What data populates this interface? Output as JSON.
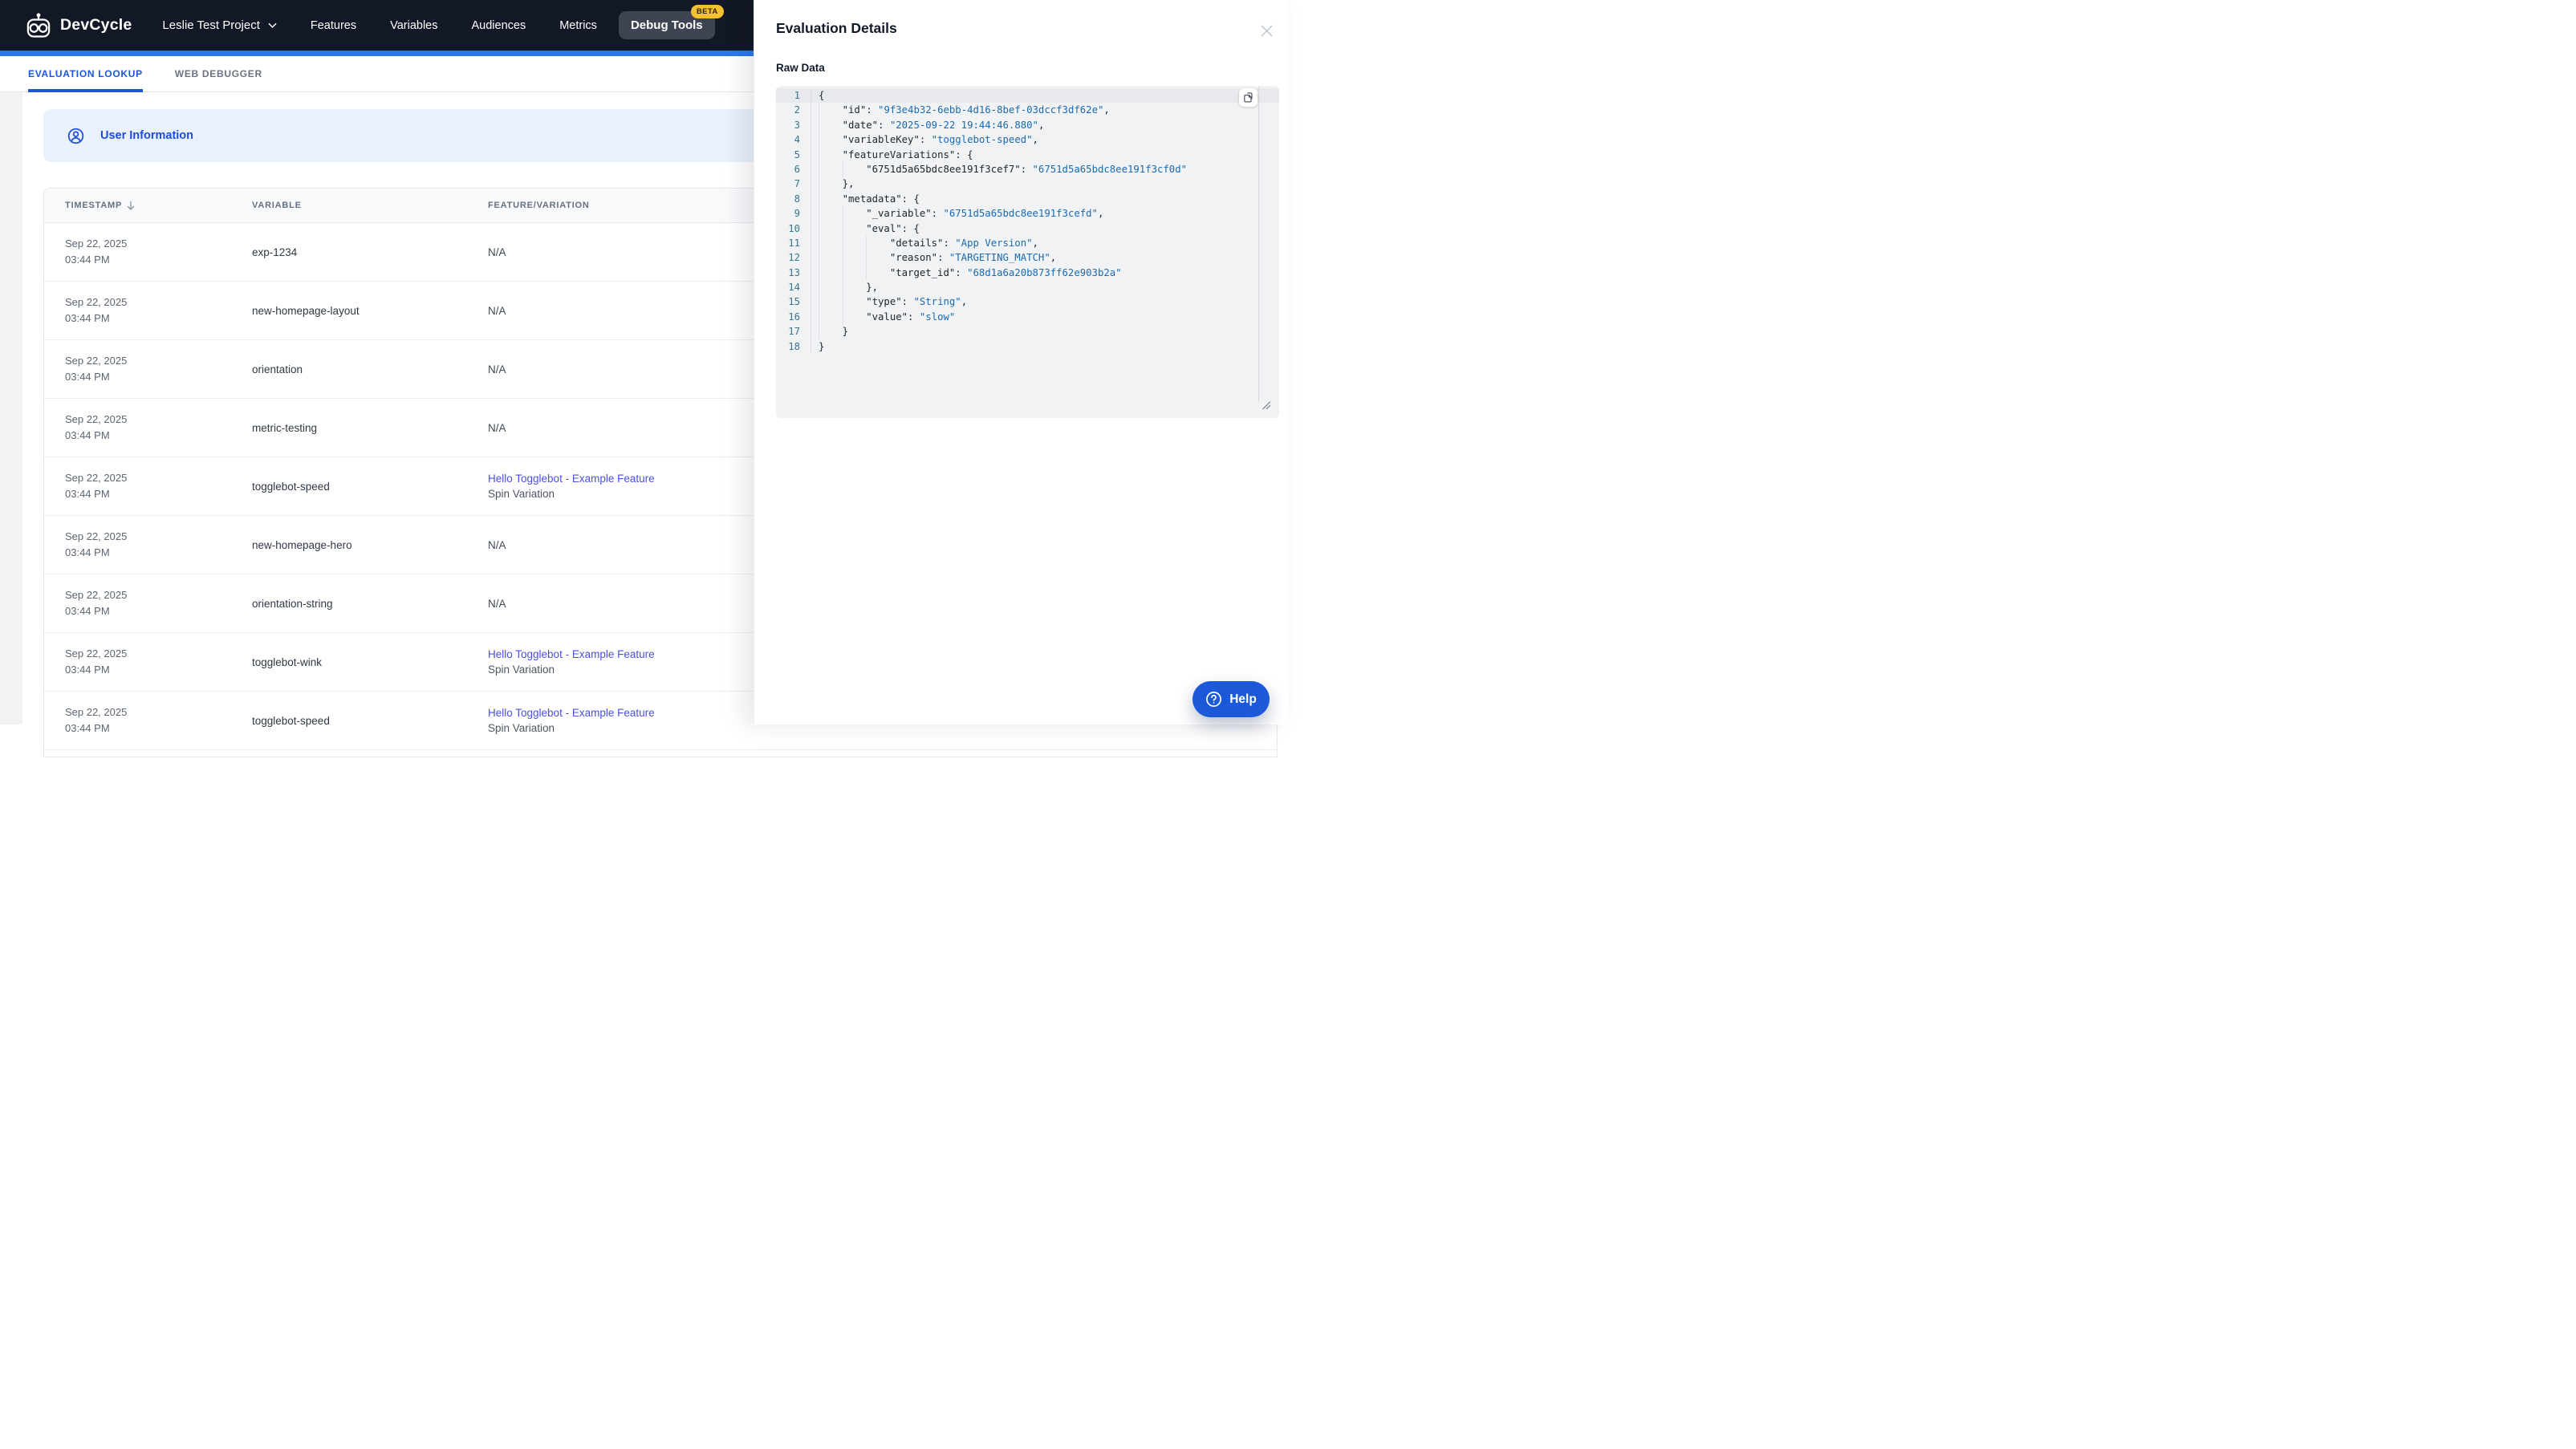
{
  "nav": {
    "brand": "DevCycle",
    "project": "Leslie Test Project",
    "items": [
      "Features",
      "Variables",
      "Audiences",
      "Metrics"
    ],
    "debug_tools": "Debug Tools",
    "beta": "BETA"
  },
  "tabs": {
    "active": "EVALUATION LOOKUP",
    "inactive": "WEB DEBUGGER"
  },
  "banner": {
    "title": "User Information"
  },
  "table": {
    "columns": [
      "TIMESTAMP",
      "VARIABLE",
      "FEATURE/VARIATION"
    ],
    "sort": {
      "column": "TIMESTAMP",
      "direction": "descending"
    },
    "rows": [
      {
        "date": "Sep 22, 2025",
        "time": "03:44 PM",
        "variable": "exp-1234",
        "feature": "N/A",
        "variation": "",
        "is_link": false
      },
      {
        "date": "Sep 22, 2025",
        "time": "03:44 PM",
        "variable": "new-homepage-layout",
        "feature": "N/A",
        "variation": "",
        "is_link": false
      },
      {
        "date": "Sep 22, 2025",
        "time": "03:44 PM",
        "variable": "orientation",
        "feature": "N/A",
        "variation": "",
        "is_link": false
      },
      {
        "date": "Sep 22, 2025",
        "time": "03:44 PM",
        "variable": "metric-testing",
        "feature": "N/A",
        "variation": "",
        "is_link": false
      },
      {
        "date": "Sep 22, 2025",
        "time": "03:44 PM",
        "variable": "togglebot-speed",
        "feature": "Hello Togglebot - Example Feature",
        "variation": "Spin Variation",
        "is_link": true
      },
      {
        "date": "Sep 22, 2025",
        "time": "03:44 PM",
        "variable": "new-homepage-hero",
        "feature": "N/A",
        "variation": "",
        "is_link": false
      },
      {
        "date": "Sep 22, 2025",
        "time": "03:44 PM",
        "variable": "orientation-string",
        "feature": "N/A",
        "variation": "",
        "is_link": false
      },
      {
        "date": "Sep 22, 2025",
        "time": "03:44 PM",
        "variable": "togglebot-wink",
        "feature": "Hello Togglebot - Example Feature",
        "variation": "Spin Variation",
        "is_link": true
      },
      {
        "date": "Sep 22, 2025",
        "time": "03:44 PM",
        "variable": "togglebot-speed",
        "feature": "Hello Togglebot - Example Feature",
        "variation": "Spin Variation",
        "is_link": true
      }
    ]
  },
  "panel": {
    "title": "Evaluation Details",
    "raw_data_label": "Raw Data",
    "code": {
      "lines": [
        {
          "n": 1,
          "ind": 0,
          "seg": [
            [
              "tp",
              "{"
            ]
          ]
        },
        {
          "n": 2,
          "ind": 1,
          "seg": [
            [
              "tk",
              "\"id\""
            ],
            [
              "tp",
              ": "
            ],
            [
              "ts",
              "\"9f3e4b32-6ebb-4d16-8bef-03dccf3df62e\""
            ],
            [
              "tp",
              ","
            ]
          ]
        },
        {
          "n": 3,
          "ind": 1,
          "seg": [
            [
              "tk",
              "\"date\""
            ],
            [
              "tp",
              ": "
            ],
            [
              "ts",
              "\"2025-09-22 19:44:46.880\""
            ],
            [
              "tp",
              ","
            ]
          ]
        },
        {
          "n": 4,
          "ind": 1,
          "seg": [
            [
              "tk",
              "\"variableKey\""
            ],
            [
              "tp",
              ": "
            ],
            [
              "ts",
              "\"togglebot-speed\""
            ],
            [
              "tp",
              ","
            ]
          ]
        },
        {
          "n": 5,
          "ind": 1,
          "seg": [
            [
              "tk",
              "\"featureVariations\""
            ],
            [
              "tp",
              ": {"
            ]
          ]
        },
        {
          "n": 6,
          "ind": 2,
          "seg": [
            [
              "tk",
              "\"6751d5a65bdc8ee191f3cef7\""
            ],
            [
              "tp",
              ": "
            ],
            [
              "ts",
              "\"6751d5a65bdc8ee191f3cf0d\""
            ]
          ]
        },
        {
          "n": 7,
          "ind": 1,
          "seg": [
            [
              "tp",
              "},"
            ]
          ]
        },
        {
          "n": 8,
          "ind": 1,
          "seg": [
            [
              "tk",
              "\"metadata\""
            ],
            [
              "tp",
              ": {"
            ]
          ]
        },
        {
          "n": 9,
          "ind": 2,
          "seg": [
            [
              "tk",
              "\"_variable\""
            ],
            [
              "tp",
              ": "
            ],
            [
              "ts",
              "\"6751d5a65bdc8ee191f3cefd\""
            ],
            [
              "tp",
              ","
            ]
          ]
        },
        {
          "n": 10,
          "ind": 2,
          "seg": [
            [
              "tk",
              "\"eval\""
            ],
            [
              "tp",
              ": {"
            ]
          ]
        },
        {
          "n": 11,
          "ind": 3,
          "seg": [
            [
              "tk",
              "\"details\""
            ],
            [
              "tp",
              ": "
            ],
            [
              "ts",
              "\"App Version\""
            ],
            [
              "tp",
              ","
            ]
          ]
        },
        {
          "n": 12,
          "ind": 3,
          "seg": [
            [
              "tk",
              "\"reason\""
            ],
            [
              "tp",
              ": "
            ],
            [
              "ts",
              "\"TARGETING_MATCH\""
            ],
            [
              "tp",
              ","
            ]
          ]
        },
        {
          "n": 13,
          "ind": 3,
          "seg": [
            [
              "tk",
              "\"target_id\""
            ],
            [
              "tp",
              ": "
            ],
            [
              "ts",
              "\"68d1a6a20b873ff62e903b2a\""
            ]
          ]
        },
        {
          "n": 14,
          "ind": 2,
          "seg": [
            [
              "tp",
              "},"
            ]
          ]
        },
        {
          "n": 15,
          "ind": 2,
          "seg": [
            [
              "tk",
              "\"type\""
            ],
            [
              "tp",
              ": "
            ],
            [
              "ts",
              "\"String\""
            ],
            [
              "tp",
              ","
            ]
          ]
        },
        {
          "n": 16,
          "ind": 2,
          "seg": [
            [
              "tk",
              "\"value\""
            ],
            [
              "tp",
              ": "
            ],
            [
              "ts",
              "\"slow\""
            ]
          ]
        },
        {
          "n": 17,
          "ind": 1,
          "seg": [
            [
              "tp",
              "}"
            ]
          ]
        },
        {
          "n": 18,
          "ind": 0,
          "seg": [
            [
              "tp",
              "}"
            ]
          ]
        }
      ]
    }
  },
  "help": {
    "label": "Help"
  },
  "colors": {
    "nav_bg": "#131826",
    "accent": "#2b78ec",
    "tab_blue": "#1a56db",
    "banner_bg": "#e9f1fc",
    "banner_blue": "#1d4ed8",
    "link": "#4b4fe2",
    "help_blue": "#1b59d9",
    "beta_bg": "#f5c12e",
    "code_bg": "#f1f2f4",
    "lnum": "#35788c",
    "str": "#1a6ab0",
    "key": "#1c2530"
  }
}
